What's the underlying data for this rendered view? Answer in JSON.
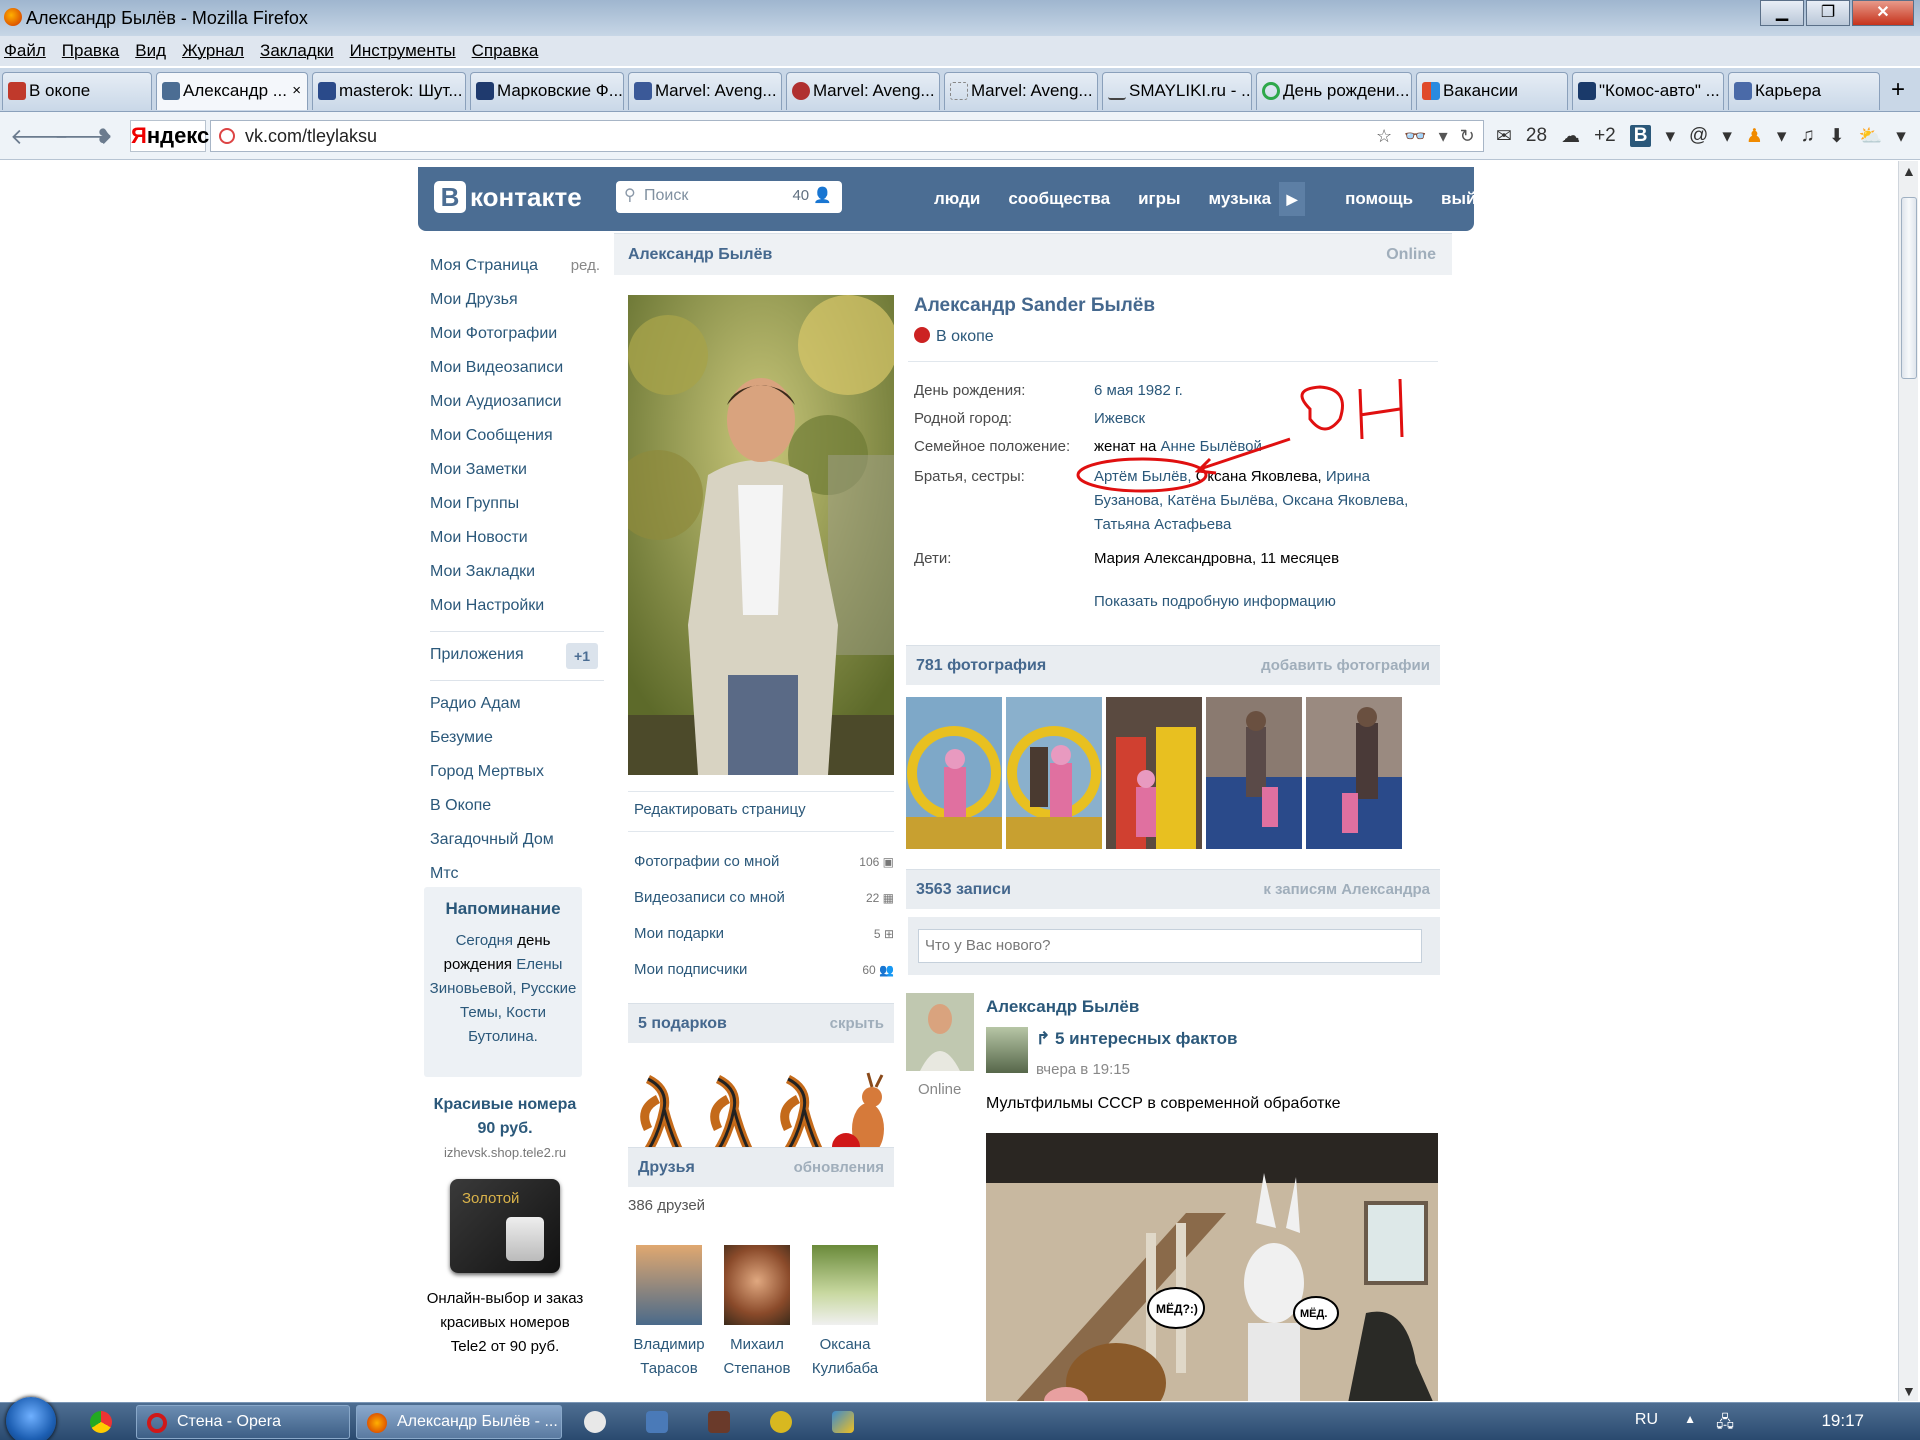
{
  "window": {
    "title": "Александр Былёв - Mozilla Firefox",
    "controls": {
      "min": "▁",
      "max": "❐",
      "close": "✕"
    }
  },
  "menu": [
    "Файл",
    "Правка",
    "Вид",
    "Журнал",
    "Закладки",
    "Инструменты",
    "Справка"
  ],
  "tabs": [
    {
      "label": "В окопе",
      "icon_color": "#c0392b"
    },
    {
      "label": "Александр ...",
      "icon_color": "#4b6d93",
      "active": true
    },
    {
      "label": "masterok: Шут...",
      "icon_color": "#2a4a8a"
    },
    {
      "label": "Марковские Ф...",
      "icon_color": "#1f3a6e"
    },
    {
      "label": "Marvel: Aveng...",
      "icon_color": "#3b5998"
    },
    {
      "label": "Marvel: Aveng...",
      "icon_color": "#b03030"
    },
    {
      "label": "Marvel: Aveng...",
      "icon_color": "#dddddd"
    },
    {
      "label": "SMAYLIKI.ru - ...",
      "icon_color": "#444444"
    },
    {
      "label": "День рождени...",
      "icon_color": "#2ea84a"
    },
    {
      "label": "Вакансии",
      "icon_color": "#e04a2a"
    },
    {
      "label": "\"Комос-авто\" ...",
      "icon_color": "#1a3a6a"
    },
    {
      "label": "Карьера",
      "icon_color": "#4a6aa8"
    }
  ],
  "tab_close": "×",
  "new_tab": "+",
  "nav": {
    "back": "🡐",
    "forward": "🡒",
    "yandex_first": "Я",
    "yandex_rest": "ндекс",
    "url": "vk.com/tleylaksu",
    "mail_count": "28",
    "weather": "+2",
    "vk_btn": "В",
    "right_icons": [
      "✉",
      "☁",
      "@",
      "♫",
      "⬇"
    ]
  },
  "vk": {
    "logo_b": "В",
    "logo_text": "контакте",
    "search_placeholder": "Поиск",
    "search_count": "40",
    "nav": [
      "люди",
      "сообщества",
      "игры",
      "музыка",
      "помощь",
      "выйти"
    ],
    "left_menu": [
      "Моя Страница",
      "Мои Друзья",
      "Мои Фотографии",
      "Мои Видеозаписи",
      "Мои Аудиозаписи",
      "Мои Сообщения",
      "Мои Заметки",
      "Мои Группы",
      "Мои Новости",
      "Мои Закладки",
      "Мои Настройки"
    ],
    "edit_short": "ред.",
    "apps_label": "Приложения",
    "apps_badge": "+1",
    "apps": [
      "Радио Адам",
      "Безумие",
      "Город Мертвых",
      "В Окопе",
      "Загадочный Дом",
      "Мтс"
    ],
    "reminder": {
      "title": "Напоминание",
      "w1": "Сегодня",
      "w2": "день",
      "w3": "рождения",
      "n1": "Елены Зиновьевой,",
      "n2": "Русские Темы,",
      "n3": "Кости Бутолина."
    },
    "ad": {
      "title": "Красивые номера 90 руб.",
      "url": "izhevsk.shop.tele2.ru",
      "card": "Золотой",
      "text": "Онлайн-выбор и заказ красивых номеров Tele2 от 90 руб."
    },
    "profile": {
      "header_name": "Александр Былёв",
      "online": "Online",
      "full_name": "Александр Sander Былёв",
      "status": "В окопе",
      "birthday_label": "День рождения:",
      "birthday": "6 мая 1982 г.",
      "hometown_label": "Родной город:",
      "hometown": "Ижевск",
      "family_label": "Семейное положение:",
      "family_pre": "женат на ",
      "family_link": "Анне Былёвой",
      "siblings_label": "Братья, сестры:",
      "sib1": "Артём Былёв,",
      "sib2": " Оксана Яковлева,",
      "sib3": " Ирина Бузанова,",
      "sib4": " Катёна Былёва,",
      "sib5": " Оксана Яковлева,",
      "sib6": " Татьяна Астафьева",
      "children_label": "Дети:",
      "children": "Мария Александровна, 11 месяцев",
      "more": "Показать подробную информацию"
    },
    "photos_section": {
      "title": "781 фотография",
      "action": "добавить фотографии"
    },
    "wall_section": {
      "title": "3563 записи",
      "action": "к записям Александра"
    },
    "post_placeholder": "Что у Вас нового?",
    "post": {
      "author": "Александр Былёв",
      "online": "Online",
      "repost_title": "5 интересных фактов",
      "repost_date": "вчера в 19:15",
      "text": "Мультфильмы СССР в современной обработке",
      "bubble1": "МЁД?:)",
      "bubble2": "МЁД."
    },
    "edit_page": "Редактировать страницу",
    "profile_menu": [
      {
        "label": "Фотографии со мной",
        "count": "106"
      },
      {
        "label": "Видеозаписи со мной",
        "count": "22"
      },
      {
        "label": "Мои подарки",
        "count": "5"
      },
      {
        "label": "Мои подписчики",
        "count": "60"
      }
    ],
    "gifts_section": {
      "title": "5 подарков",
      "action": "скрыть"
    },
    "friends_section": {
      "title": "Друзья",
      "action": "обновления",
      "count": "386 друзей"
    },
    "friends": [
      {
        "first": "Владимир",
        "last": "Тарасов"
      },
      {
        "first": "Михаил",
        "last": "Степанов"
      },
      {
        "first": "Оксана",
        "last": "Кулибаба"
      }
    ],
    "annotation": "ОН"
  },
  "taskbar": {
    "items": [
      {
        "label": "Стена - Opera",
        "icon_color": "#d01818"
      },
      {
        "label": "Александр Былёв - ...",
        "icon_color": "#e8731a"
      }
    ],
    "lang": "RU",
    "time": "19:17"
  }
}
